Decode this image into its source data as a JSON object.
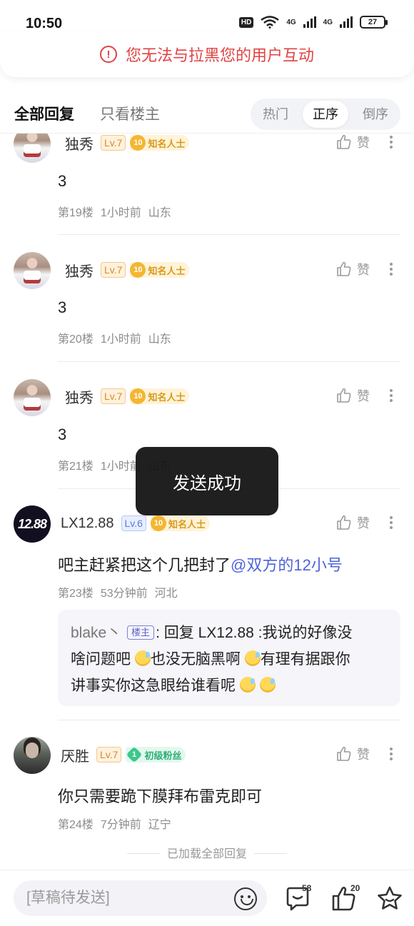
{
  "status_bar": {
    "time": "10:50",
    "hd": "HD",
    "net1": "4G",
    "net2": "4G",
    "battery": "27"
  },
  "warning": {
    "text": "您无法与拉黑您的用户互动"
  },
  "tabs": {
    "all": "全部回复",
    "owner_only": "只看楼主"
  },
  "sort": {
    "options": [
      "热门",
      "正序",
      "倒序"
    ],
    "active": "正序"
  },
  "comments": [
    {
      "user": "独秀",
      "level": "Lv.7",
      "badge_num": "10",
      "badge_label": "知名人士",
      "text": "3",
      "floor": "第19楼",
      "time": "1小时前",
      "location": "山东",
      "like_label": "赞"
    },
    {
      "user": "独秀",
      "level": "Lv.7",
      "badge_num": "10",
      "badge_label": "知名人士",
      "text": "3",
      "floor": "第20楼",
      "time": "1小时前",
      "location": "山东",
      "like_label": "赞"
    },
    {
      "user": "独秀",
      "level": "Lv.7",
      "badge_num": "10",
      "badge_label": "知名人士",
      "text": "3",
      "floor": "第21楼",
      "time": "1小时前",
      "location": "山东",
      "like_label": "赞"
    },
    {
      "user": "LX12.88",
      "avatar_text": "12.88",
      "level": "Lv.6",
      "badge_num": "10",
      "badge_label": "知名人士",
      "text": "吧主赶紧把这个几把封了",
      "mention": "@双方的12小号",
      "floor": "第23楼",
      "time": "53分钟前",
      "location": "河北",
      "like_label": "赞",
      "reply": {
        "user": "blake丶",
        "owner_tag": "楼主",
        "colon": ":",
        "prefix": "回复 LX12.88 :我说的好像没",
        "line2a": "啥问题吧",
        "line2b": "也没无脑黑啊",
        "line2c": "有理有据跟你",
        "line3": "讲事实你这急眼给谁看呢"
      }
    },
    {
      "user": "厌胜",
      "level": "Lv.7",
      "badge_num": "1",
      "badge_label": "初级粉丝",
      "text": "你只需要跪下膜拜布雷克即可",
      "floor": "第24楼",
      "time": "7分钟前",
      "location": "辽宁",
      "like_label": "赞"
    }
  ],
  "toast": {
    "text": "发送成功"
  },
  "footer": {
    "loaded_all": "已加载全部回复"
  },
  "bottom_bar": {
    "draft_placeholder": "[草稿待发送]",
    "comment_count": "58",
    "like_count": "20"
  }
}
